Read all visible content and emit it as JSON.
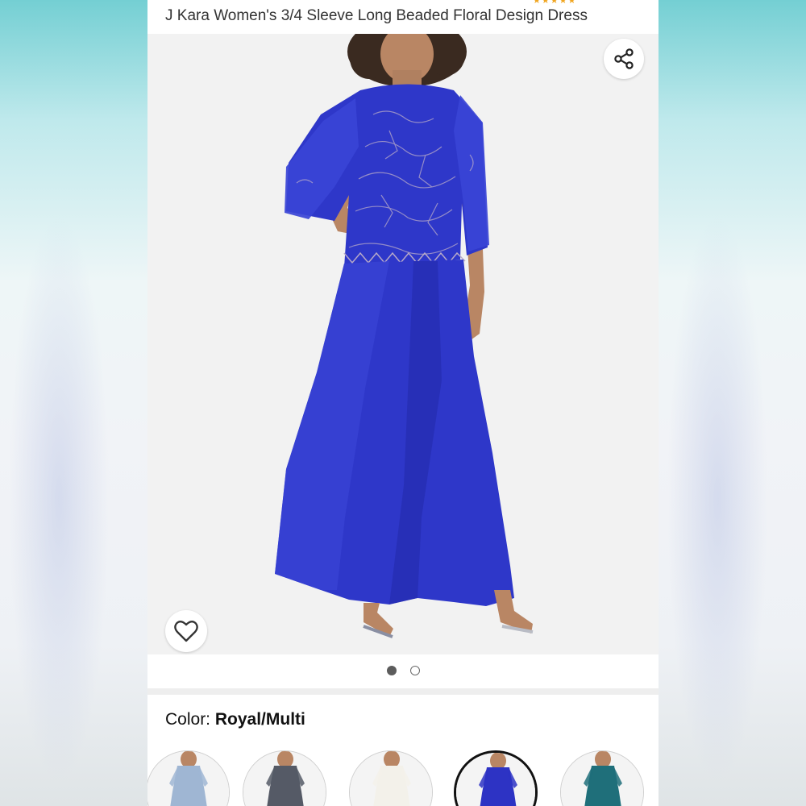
{
  "product": {
    "title": "J Kara Women's 3/4 Sleeve Long Beaded Floral Design Dress",
    "rating_stars": "★★★★★"
  },
  "gallery": {
    "image_count": 2,
    "active_index": 0
  },
  "color": {
    "label": "Color:",
    "value": "Royal/Multi"
  },
  "swatches": [
    {
      "name": "light-blue",
      "color": "#9fb6d3",
      "selected": false
    },
    {
      "name": "charcoal",
      "color": "#555a66",
      "selected": false
    },
    {
      "name": "ivory",
      "color": "#f3f1ea",
      "selected": false
    },
    {
      "name": "royal",
      "color": "#2d33c4",
      "selected": true
    },
    {
      "name": "teal",
      "color": "#1f6f7a",
      "selected": false
    }
  ],
  "colors": {
    "dress": "#2e37c9",
    "dress_shadow": "#2229a8",
    "skin": "#b98664",
    "hair": "#3a2a20",
    "background_image": "#f2f2f2"
  },
  "icons": {
    "share": "share-icon",
    "wishlist": "heart-icon"
  }
}
